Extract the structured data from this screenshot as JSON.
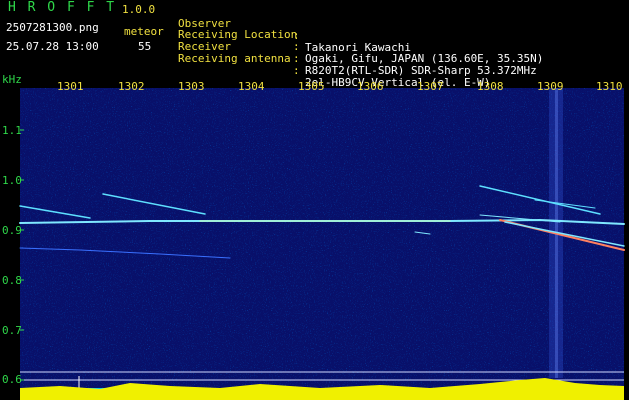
{
  "app": {
    "name": "H R O F F T",
    "version": "1.0.0",
    "filename": "2507281300.png",
    "datetime": "25.07.28 13:00",
    "counter_label": "meteor",
    "counter_value": "55"
  },
  "header": {
    "rows": [
      {
        "key": "Observer",
        "value": "Takanori Kawachi"
      },
      {
        "key": "Receiving Location",
        "value": "Ogaki, Gifu, JAPAN (136.60E, 35.35N)"
      },
      {
        "key": "Receiver",
        "value": "R820T2(RTL-SDR) SDR-Sharp 53.372MHz"
      },
      {
        "key": "Receiving antenna",
        "value": "2el-HB9CV Vertical (el. E-W)"
      }
    ],
    "separator": ":"
  },
  "axes": {
    "y_unit": "kHz",
    "y_ticks": [
      "1.1",
      "1.0",
      "0.9",
      "0.8",
      "0.7",
      "0.6"
    ],
    "x_ticks": [
      "1301",
      "1302",
      "1303",
      "1304",
      "1305",
      "1306",
      "1307",
      "1308",
      "1309",
      "1310"
    ]
  },
  "colors": {
    "background": "#000000",
    "spectrum_bg": "#08106a",
    "label_green": "#2fd84a",
    "label_yellow": "#f0e040",
    "trace_cyan": "#7fe8ff",
    "bar_yellow": "#f0f000",
    "bar_cyan": "#00c8ff"
  }
}
